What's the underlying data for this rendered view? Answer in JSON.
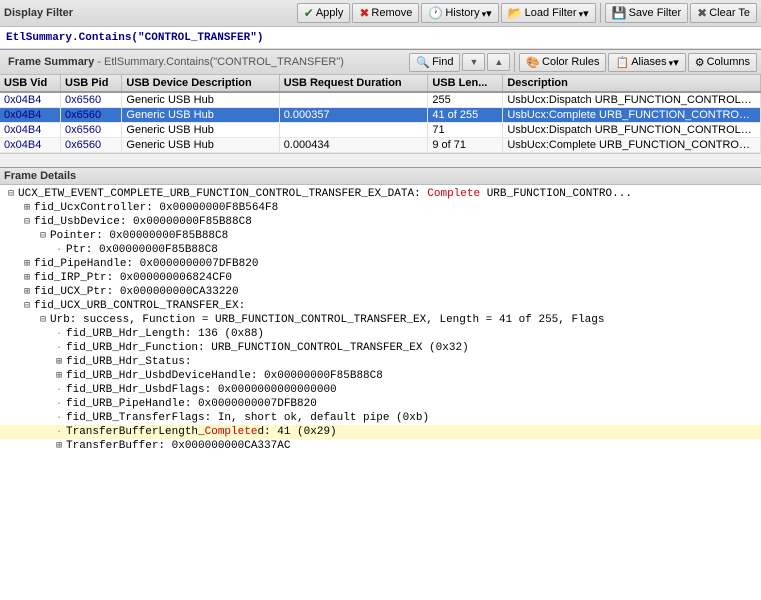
{
  "displayFilter": {
    "title": "Display Filter",
    "buttons": {
      "apply": "Apply",
      "remove": "Remove",
      "history": "History",
      "loadFilter": "Load Filter",
      "saveFilter": "Save Filter",
      "clear": "Clear Te"
    },
    "filterText": "EtlSummary.Contains(\"CONTROL_TRANSFER\")"
  },
  "frameSummary": {
    "title": "Frame Summary",
    "subtitle": "EtlSummary.Contains(\"CONTROL_TRANSFER\")",
    "toolbar": {
      "find": "Find",
      "colorRules": "Color Rules",
      "aliases": "Aliases",
      "columns": "Columns"
    },
    "columns": [
      "USB Vid",
      "USB Pid",
      "USB Device Description",
      "USB Request Duration",
      "USB Len...",
      "Description"
    ],
    "rows": [
      {
        "vid": "0x04B4",
        "pid": "0x6560",
        "device": "Generic USB Hub",
        "duration": "",
        "length": "255",
        "description": "UsbUcx:Dispatch URB_FUNCTION_CONTROL_TRANSFER_EX"
      },
      {
        "vid": "0x04B4",
        "pid": "0x6560",
        "device": "Generic USB Hub",
        "duration": "0.000357",
        "length": "41 of 255",
        "description": "UsbUcx:Complete URB_FUNCTION_CONTROL_TRANSFER_EX with data"
      },
      {
        "vid": "0x04B4",
        "pid": "0x6560",
        "device": "Generic USB Hub",
        "duration": "",
        "length": "71",
        "description": "UsbUcx:Dispatch URB_FUNCTION_CONTROL_TRANSFER_EX"
      },
      {
        "vid": "0x04B4",
        "pid": "0x6560",
        "device": "Generic USB Hub",
        "duration": "0.000434",
        "length": "9 of 71",
        "description": "UsbUcx:Complete URB_FUNCTION_CONTROL_TRANSFER_EX with data"
      }
    ]
  },
  "frameDetails": {
    "title": "Frame Details",
    "treeNodes": [
      {
        "indent": 0,
        "toggle": "minus",
        "text": "UCX_ETW_EVENT_COMPLETE_URB_FUNCTION_CONTROL_TRANSFER_EX_DATA: Complete URB_FUNCTION_CONTRO...",
        "highlight": false
      },
      {
        "indent": 1,
        "toggle": "plus",
        "text": "fid_UcxController: 0x00000000F8B564F8",
        "highlight": false
      },
      {
        "indent": 1,
        "toggle": "minus",
        "text": "fid_UsbDevice: 0x00000000F85B88C8",
        "highlight": false
      },
      {
        "indent": 2,
        "toggle": "minus",
        "text": "Pointer: 0x00000000F85B88C8",
        "highlight": false
      },
      {
        "indent": 3,
        "toggle": "dot",
        "text": "Ptr: 0x00000000F85B88C8",
        "highlight": false
      },
      {
        "indent": 1,
        "toggle": "plus",
        "text": "fid_PipeHandle: 0x0000000007DFB820",
        "highlight": false
      },
      {
        "indent": 1,
        "toggle": "plus",
        "text": "fid_IRP_Ptr: 0x000000006824CF0",
        "highlight": false
      },
      {
        "indent": 1,
        "toggle": "plus",
        "text": "fid_UCX_Ptr: 0x000000000CA33220",
        "highlight": false
      },
      {
        "indent": 1,
        "toggle": "minus",
        "text": "fid_UCX_URB_CONTROL_TRANSFER_EX:",
        "highlight": false
      },
      {
        "indent": 2,
        "toggle": "minus",
        "text": "Urb: success, Function = URB_FUNCTION_CONTROL_TRANSFER_EX, Length = 41 of 255, Flags",
        "highlight": false
      },
      {
        "indent": 3,
        "toggle": "dot",
        "text": "fid_URB_Hdr_Length: 136 (0x88)",
        "highlight": false
      },
      {
        "indent": 3,
        "toggle": "dot",
        "text": "fid_URB_Hdr_Function: URB_FUNCTION_CONTROL_TRANSFER_EX (0x32)",
        "highlight": false
      },
      {
        "indent": 3,
        "toggle": "plus",
        "text": "fid_URB_Hdr_Status:",
        "highlight": false
      },
      {
        "indent": 3,
        "toggle": "plus",
        "text": "fid_URB_Hdr_UsbdDeviceHandle: 0x00000000F85B88C8",
        "highlight": false
      },
      {
        "indent": 3,
        "toggle": "dot",
        "text": "fid_URB_Hdr_UsbdFlags: 0x0000000000000000",
        "highlight": false
      },
      {
        "indent": 3,
        "toggle": "dot",
        "text": "fid_URB_PipeHandle: 0x0000000007DFB820",
        "highlight": false
      },
      {
        "indent": 3,
        "toggle": "dot",
        "text": "fid_URB_TransferFlags: In, short ok, default pipe (0xb)",
        "highlight": false
      },
      {
        "indent": 3,
        "toggle": "dot",
        "text": "TransferBufferLength_Completed: 41 (0x29)",
        "highlight": true
      },
      {
        "indent": 3,
        "toggle": "plus",
        "text": "TransferBuffer: 0x000000000CA337AC",
        "highlight": false
      }
    ]
  }
}
